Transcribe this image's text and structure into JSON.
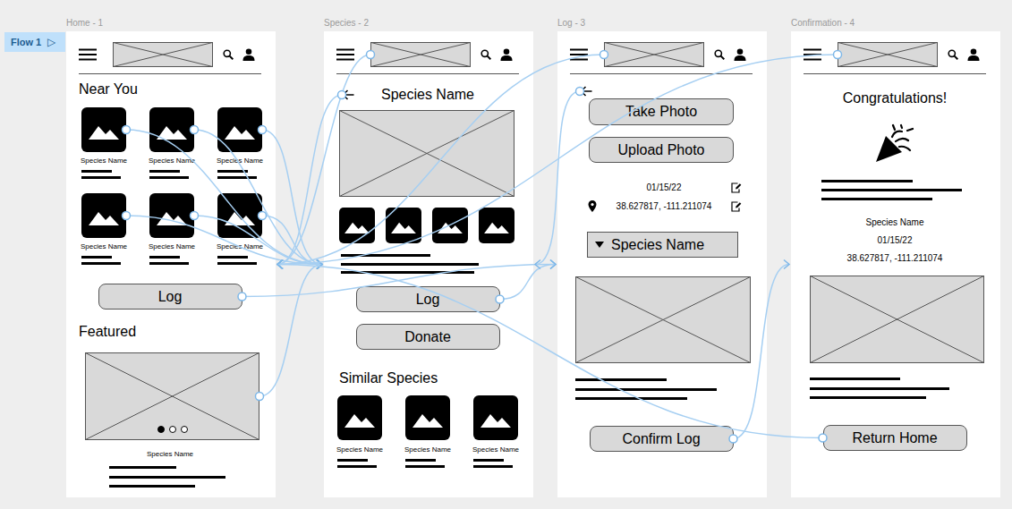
{
  "flow": {
    "label": "Flow 1",
    "icon": "▷"
  },
  "screens": [
    {
      "kind": "home",
      "title": "Home - 1",
      "near_you_title": "Near You",
      "near_you": [
        {
          "name": "Species Name"
        },
        {
          "name": "Species Name"
        },
        {
          "name": "Species Name"
        },
        {
          "name": "Species Name"
        },
        {
          "name": "Species Name"
        },
        {
          "name": "Species Name"
        }
      ],
      "log_button": "Log",
      "featured_title": "Featured",
      "featured_caption": "Species Name",
      "featured_dots": [
        {
          "selected": true
        },
        {
          "selected": false
        },
        {
          "selected": false
        }
      ]
    },
    {
      "kind": "species",
      "title": "Species - 2",
      "heading": "Species Name",
      "log_button": "Log",
      "donate_button": "Donate",
      "similar_title": "Similar Species",
      "similar": [
        {
          "name": "Species Name"
        },
        {
          "name": "Species Name"
        },
        {
          "name": "Species Name"
        }
      ]
    },
    {
      "kind": "log",
      "title": "Log - 3",
      "take_photo_button": "Take Photo",
      "upload_photo_button": "Upload Photo",
      "date": "01/15/22",
      "coordinates": "38.627817, -111.211074",
      "species_select": "Species Name",
      "confirm_button": "Confirm Log"
    },
    {
      "kind": "confirmation",
      "title": "Confirmation - 4",
      "heading": "Congratulations!",
      "species": "Species Name",
      "date": "01/15/22",
      "coordinates": "38.627817, -111.211074",
      "return_button": "Return Home"
    }
  ],
  "links": [
    {
      "from": "screens.0.near_you.0",
      "to": 1
    },
    {
      "from": "screens.0.near_you.1",
      "to": 1
    },
    {
      "from": "screens.0.near_you.2",
      "to": 1
    },
    {
      "from": "screens.0.near_you.3",
      "to": 1
    },
    {
      "from": "screens.0.near_you.4",
      "to": 1
    },
    {
      "from": "screens.0.near_you.5",
      "to": 1
    },
    {
      "from": "screens.0.featured",
      "to": 1
    },
    {
      "from": "screens.0.log_button",
      "to": 2
    },
    {
      "from": "screens.1.logo",
      "to": 0
    },
    {
      "from": "screens.1.back",
      "to": 0
    },
    {
      "from": "screens.1.log_button",
      "to": 2
    },
    {
      "from": "screens.2.logo",
      "to": 0
    },
    {
      "from": "screens.2.back",
      "to": 1
    },
    {
      "from": "screens.2.confirm_button",
      "to": 3
    },
    {
      "from": "screens.3.logo",
      "to": 0
    },
    {
      "from": "screens.3.return_button",
      "to": 0
    }
  ]
}
